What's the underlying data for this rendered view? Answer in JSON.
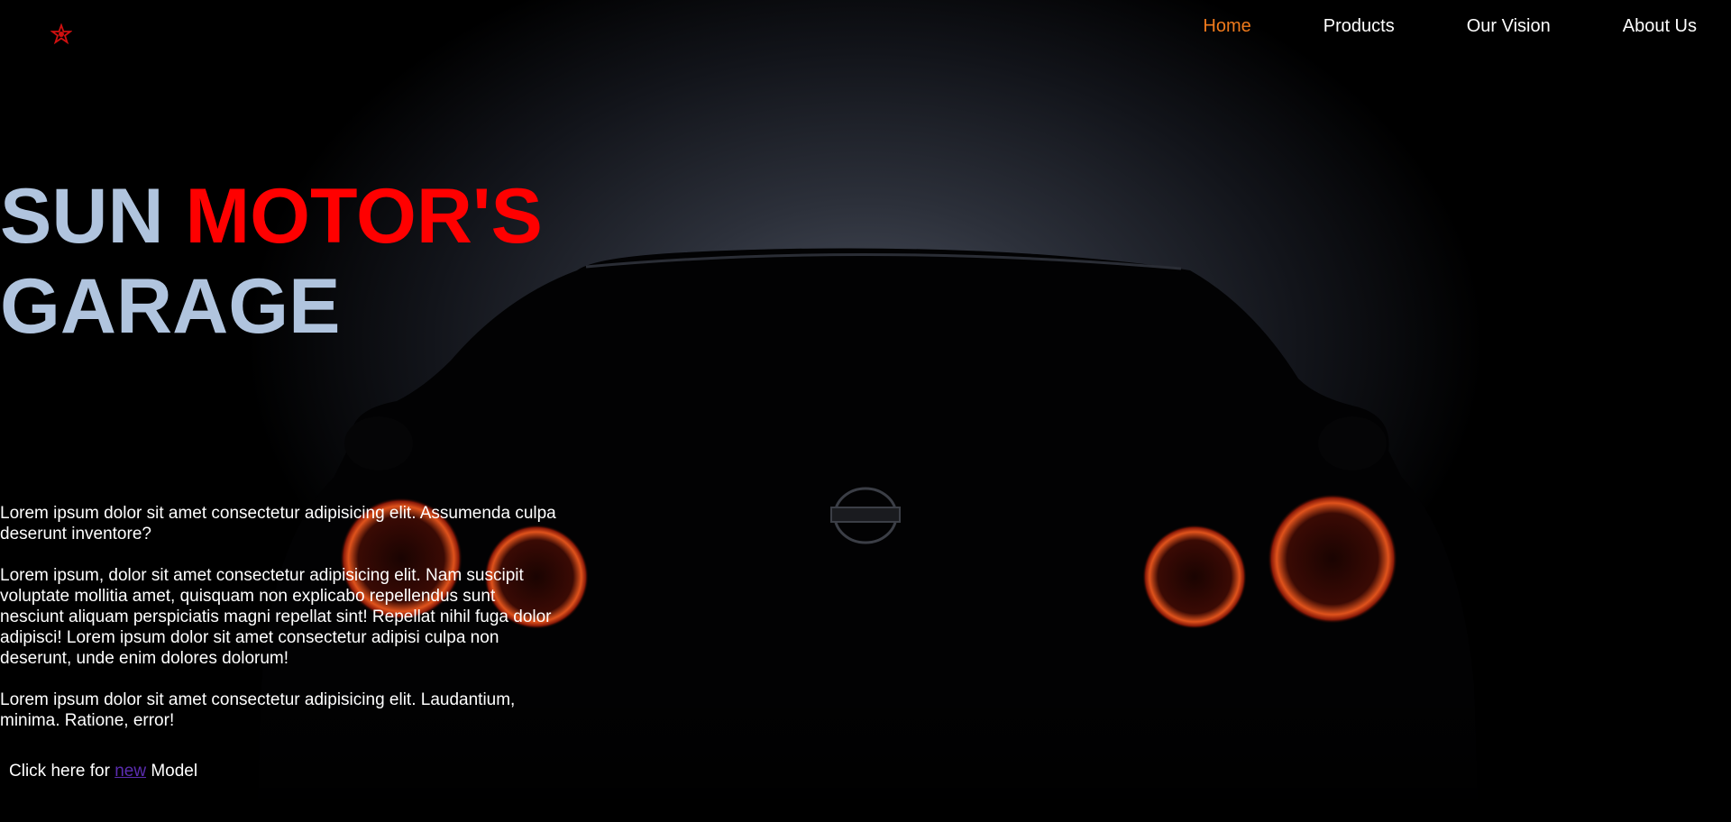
{
  "nav": {
    "items": [
      {
        "label": "Home",
        "active": true
      },
      {
        "label": "Products",
        "active": false
      },
      {
        "label": "Our Vision",
        "active": false
      },
      {
        "label": "About Us",
        "active": false
      }
    ],
    "logo_icon": "star-pentagram-icon"
  },
  "hero": {
    "title_part1": "SUN",
    "title_part2": "MOTOR'S",
    "title_line2": "GARAGE",
    "paragraphs": [
      "Lorem ipsum dolor sit amet consectetur adipisicing elit. Assumenda culpa deserunt inventore?",
      "Lorem ipsum, dolor sit amet consectetur adipisicing elit. Nam suscipit voluptate mollitia amet, quisquam non explicabo repellendus sunt nesciunt aliquam perspiciatis magni repellat sint! Repellat nihil fuga dolor adipisci! Lorem ipsum dolor sit amet consectetur adipisi culpa non deserunt, unde enim dolores dolorum!",
      "Lorem ipsum dolor sit amet consectetur adipisicing elit. Laudantium, minima. Ratione, error!"
    ],
    "cta_prefix": "Click here for",
    "cta_link": "new",
    "cta_suffix": "Model"
  },
  "colors": {
    "title": "#b0c4de",
    "title_accent": "#ff0000",
    "nav_active": "#f07a1c",
    "link": "#5b2db0"
  }
}
